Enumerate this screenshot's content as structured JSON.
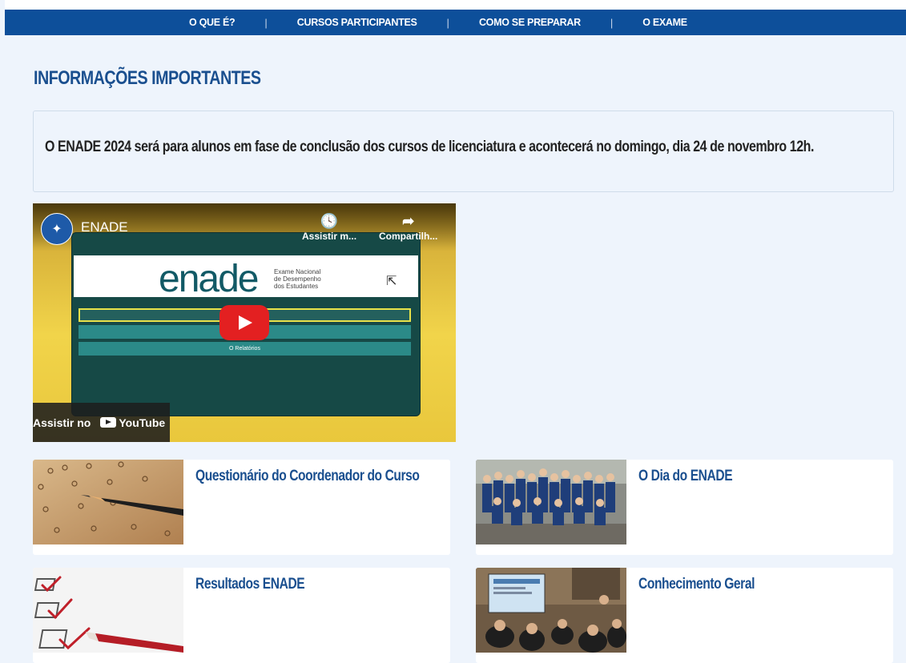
{
  "nav": {
    "items": [
      "O QUE É?",
      "CURSOS PARTICIPANTES",
      "COMO SE PREPARAR",
      "O EXAME"
    ],
    "separator": "|"
  },
  "section_title": "INFORMAÇÕES IMPORTANTES",
  "notice": {
    "text": "O ENADE 2024 será para alunos em fase de conclusão dos cursos de licenciatura e acontecerá no domingo, dia 24 de novembro 12h."
  },
  "video": {
    "title": "ENADE",
    "watch_later_label": "Assistir m...",
    "share_label": "Compartilh...",
    "watch_on_label": "Assistir no",
    "youtube_label": "YouTube",
    "screen_wordmark": "enade",
    "screen_subtitle": [
      "Exame Nacional",
      "de Desempenho",
      "dos Estudantes"
    ],
    "screen_menu": [
      "",
      "",
      "O Relatórios"
    ]
  },
  "cards": [
    {
      "title": "Questionário do Coordenador do Curso",
      "image": "answer-sheet-pencil"
    },
    {
      "title": "O Dia do ENADE",
      "image": "group-photo"
    },
    {
      "title": "Resultados ENADE",
      "image": "checkboxes-marker"
    },
    {
      "title": "Conhecimento Geral",
      "image": "classroom"
    }
  ],
  "colors": {
    "nav_bg": "#0d4f9a",
    "page_bg": "#eef4fc",
    "title_blue": "#1a4f8f",
    "play_red": "#e32021"
  }
}
